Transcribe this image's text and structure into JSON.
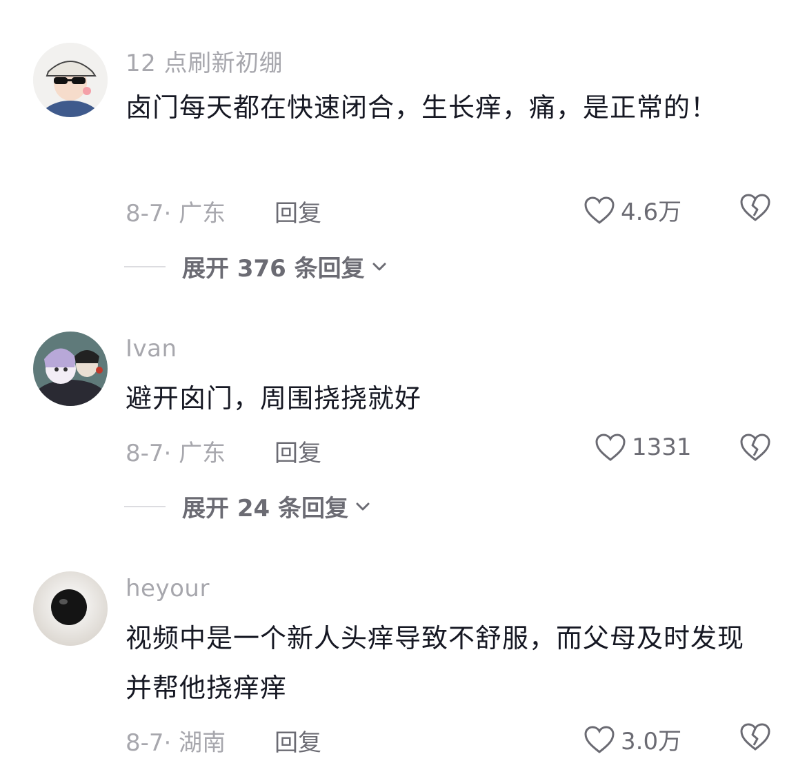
{
  "comments": [
    {
      "username": "12 点刷新初绷",
      "text": "卤门每天都在快速闭合，生长痒，痛，是正常的！",
      "date_location": "8-7· 广东",
      "reply_label": "回复",
      "likes": "4.6万",
      "expand_label": "展开 376 条回复",
      "avatar_icon": "avatar-cartoon-cap-sunglasses"
    },
    {
      "username": "Ivan",
      "text": "避开囟门，周围挠挠就好",
      "date_location": "8-7· 广东",
      "reply_label": "回复",
      "likes": "1331",
      "expand_label": "展开 24 条回复",
      "avatar_icon": "avatar-anime-group"
    },
    {
      "username": "heyour",
      "text": "视频中是一个新人头痒导致不舒服，而父母及时发现并帮他挠痒痒",
      "date_location": "8-7· 湖南",
      "reply_label": "回复",
      "likes": "3.0万",
      "avatar_icon": "avatar-dog-nose"
    }
  ],
  "icons": {
    "like": "heart-outline-icon",
    "dislike": "broken-heart-icon",
    "expand": "chevron-down-icon"
  },
  "colors": {
    "text_primary": "#161823",
    "text_secondary": "#a7a7ad",
    "text_action": "#6b6b73"
  }
}
